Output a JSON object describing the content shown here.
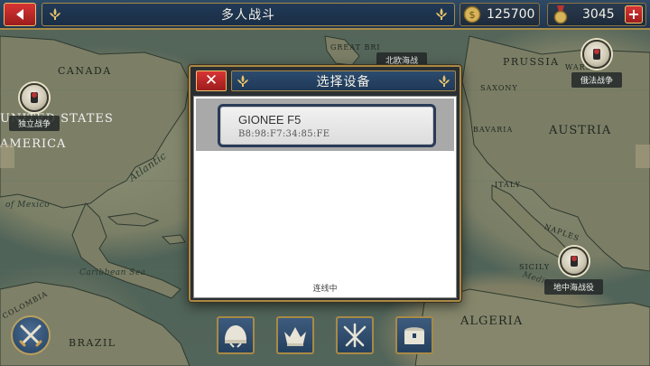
{
  "topbar": {
    "title": "多人战斗",
    "coins": "125700",
    "medals": "3045",
    "plus_label": "+"
  },
  "map": {
    "labels": {
      "canada": "CANADA",
      "united_states": "UNITED STATES",
      "america": "AMERICA",
      "atlantic": "Atlantic",
      "gulf_of_mexico": "of Mexico",
      "caribbean": "Caribbean Sea",
      "colombia": "COLOMBIA",
      "brazil": "BRAZIL",
      "great_britain": "GREAT BRI",
      "prussia": "PRUSSIA",
      "warsaw": "WARSAW",
      "saxony": "SAXONY",
      "bavaria": "BAVARIA",
      "austria": "AUSTRIA",
      "italy": "ITALY",
      "naples": "NAPLES",
      "sicily": "SICILY",
      "algeria": "ALGERIA",
      "mediterranean": "Mediterr"
    },
    "battles": [
      {
        "label": "独立战争"
      },
      {
        "label": "北欧海战"
      },
      {
        "label": "俄法战争"
      },
      {
        "label": "地中海战役"
      }
    ]
  },
  "dialog": {
    "close_label": "✕",
    "title": "选择设备",
    "device": {
      "name": "GIONEE F5",
      "mac": "B8:98:F7:34:85:FE"
    },
    "status": "连线中"
  },
  "colors": {
    "accent_gold": "#a88a45",
    "button_red": "#c62828",
    "header_blue": "#24405f"
  }
}
